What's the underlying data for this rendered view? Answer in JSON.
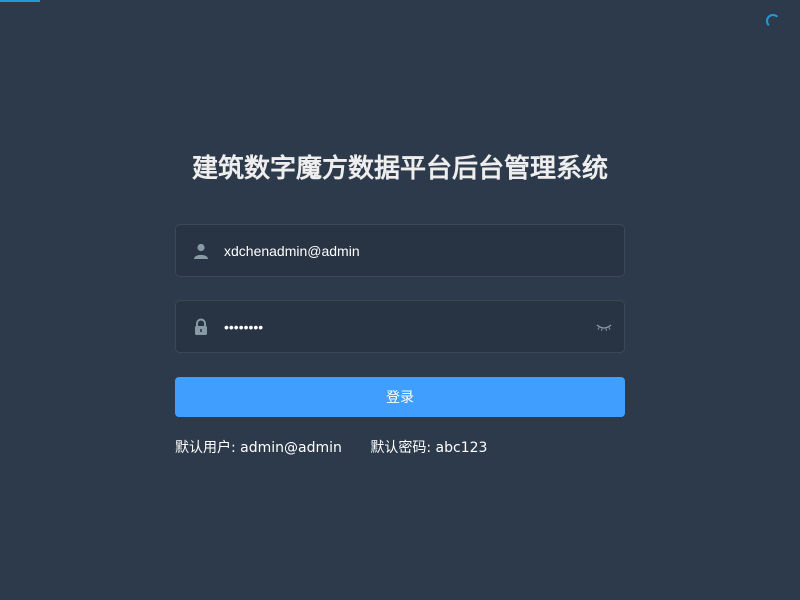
{
  "page": {
    "title": "建筑数字魔方数据平台后台管理系统"
  },
  "login_form": {
    "username": {
      "value": "xdchenadmin@admin",
      "icon": "user-icon"
    },
    "password": {
      "value": "abc12345",
      "icon": "lock-icon",
      "toggle_icon": "eye-closed-icon"
    },
    "submit_label": "登录"
  },
  "tips": {
    "default_user": "默认用户: admin@admin",
    "default_password": "默认密码: abc123"
  },
  "colors": {
    "background": "#2d3a4b",
    "input_background": "#283443",
    "primary": "#409eff",
    "loader": "#2299dd"
  }
}
